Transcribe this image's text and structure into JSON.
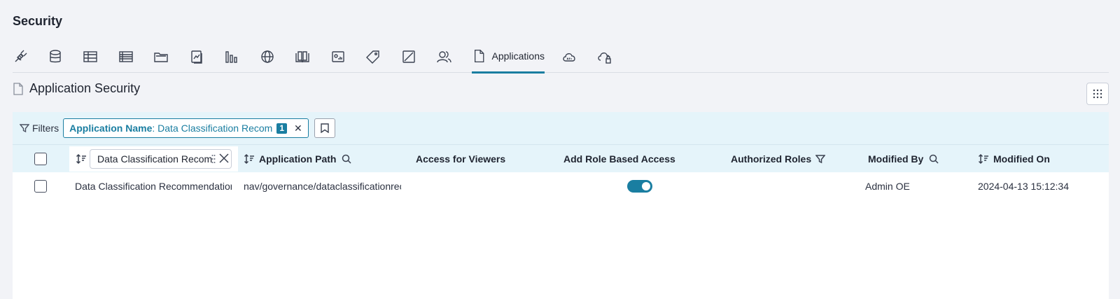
{
  "page": {
    "title": "Security"
  },
  "tabs": [
    {
      "icon": "plug-icon"
    },
    {
      "icon": "database-icon"
    },
    {
      "icon": "table-icon"
    },
    {
      "icon": "columns-table-icon"
    },
    {
      "icon": "folder-icon"
    },
    {
      "icon": "report-icon"
    },
    {
      "icon": "bar-chart-icon"
    },
    {
      "icon": "globe-icon"
    },
    {
      "icon": "book-icon"
    },
    {
      "icon": "dashboard-icon"
    },
    {
      "icon": "tag-icon"
    },
    {
      "icon": "chart-line-icon"
    },
    {
      "icon": "users-icon"
    },
    {
      "icon": "document-icon",
      "label": "Applications",
      "active": true
    },
    {
      "icon": "cloud-api-icon"
    },
    {
      "icon": "cloud-api-lock-icon"
    }
  ],
  "section": {
    "title": "Application Security"
  },
  "filters": {
    "label": "Filters",
    "chip": {
      "key": "Application Name",
      "value": ": Data Classification Recom",
      "count": "1"
    }
  },
  "table": {
    "column_filter_value": "Data Classification Recom",
    "headers": {
      "path": "Application Path",
      "viewers": "Access for Viewers",
      "role_access": "Add Role Based Access",
      "roles": "Authorized Roles",
      "modified_by": "Modified By",
      "modified_on": "Modified On"
    },
    "rows": [
      {
        "name": "Data Classification Recommendation",
        "path": "nav/governance/dataclassificationrecommendation",
        "viewers": "",
        "role_access": true,
        "roles": "",
        "modified_by": "Admin OE",
        "modified_on": "2024-04-13 15:12:34"
      }
    ]
  },
  "colors": {
    "accent": "#1a7ea1",
    "filter_bg": "#e5f4fa",
    "page_bg": "#f2f3f7"
  }
}
